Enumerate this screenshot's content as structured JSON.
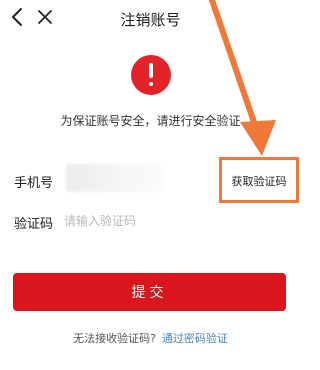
{
  "header": {
    "title": "注销账号",
    "back_icon": "chevron-left-icon",
    "close_icon": "close-icon"
  },
  "notice": {
    "icon": "exclamation-circle-icon",
    "text": "为保证账号安全，请进行安全验证"
  },
  "phone": {
    "label": "手机号",
    "get_code_label": "获取验证码"
  },
  "code": {
    "label": "验证码",
    "placeholder": "请输入验证码"
  },
  "submit_label": "提交",
  "footer": {
    "question": "无法接收验证码?",
    "link": "通过密码验证"
  },
  "colors": {
    "primary": "#d9161e",
    "annotation": "#f07838",
    "link": "#4a86c5"
  }
}
